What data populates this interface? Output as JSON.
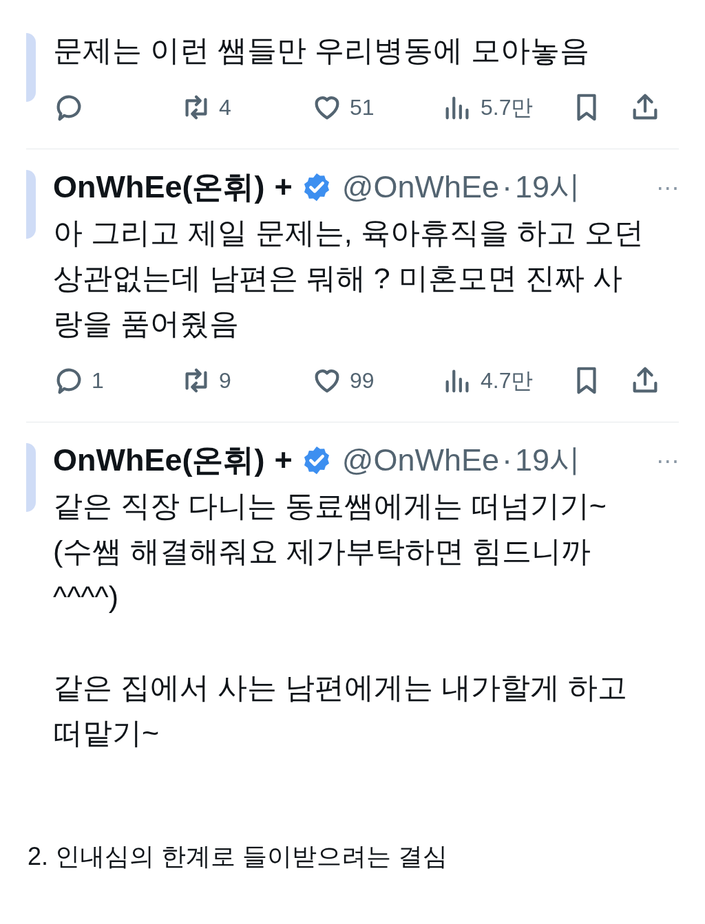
{
  "tweets": [
    {
      "paragraphs": [
        "문제는 이런 쌤들만 우리병동에 모아놓음"
      ],
      "actions": {
        "retweets": "4",
        "likes": "51",
        "views": "5.7만"
      }
    },
    {
      "author": {
        "name": "OnWhEe(온휘)",
        "plus": "+",
        "handle": "@OnWhEe",
        "separator": "·",
        "time": "19시",
        "more": "···"
      },
      "paragraphs": [
        "아 그리고 제일 문제는, 육아휴직을 하고 오던\n상관없는데 남편은 뭐해 ? 미혼모면 진짜 사\n랑을 품어줬음"
      ],
      "actions": {
        "replies": "1",
        "retweets": "9",
        "likes": "99",
        "views": "4.7만"
      }
    },
    {
      "author": {
        "name": "OnWhEe(온휘)",
        "plus": "+",
        "handle": "@OnWhEe",
        "separator": "·",
        "time": "19시",
        "more": "···"
      },
      "paragraphs": [
        "같은 직장 다니는 동료쌤에게는 떠넘기기~\n(수쌤 해결해줘요 제가부탁하면 힘드니까\n^^^^)",
        "같은 집에서 사는 남편에게는 내가할게 하고\n떠맡기~"
      ]
    }
  ],
  "caption": "2. 인내심의 한계로 들이받으려는 결심"
}
